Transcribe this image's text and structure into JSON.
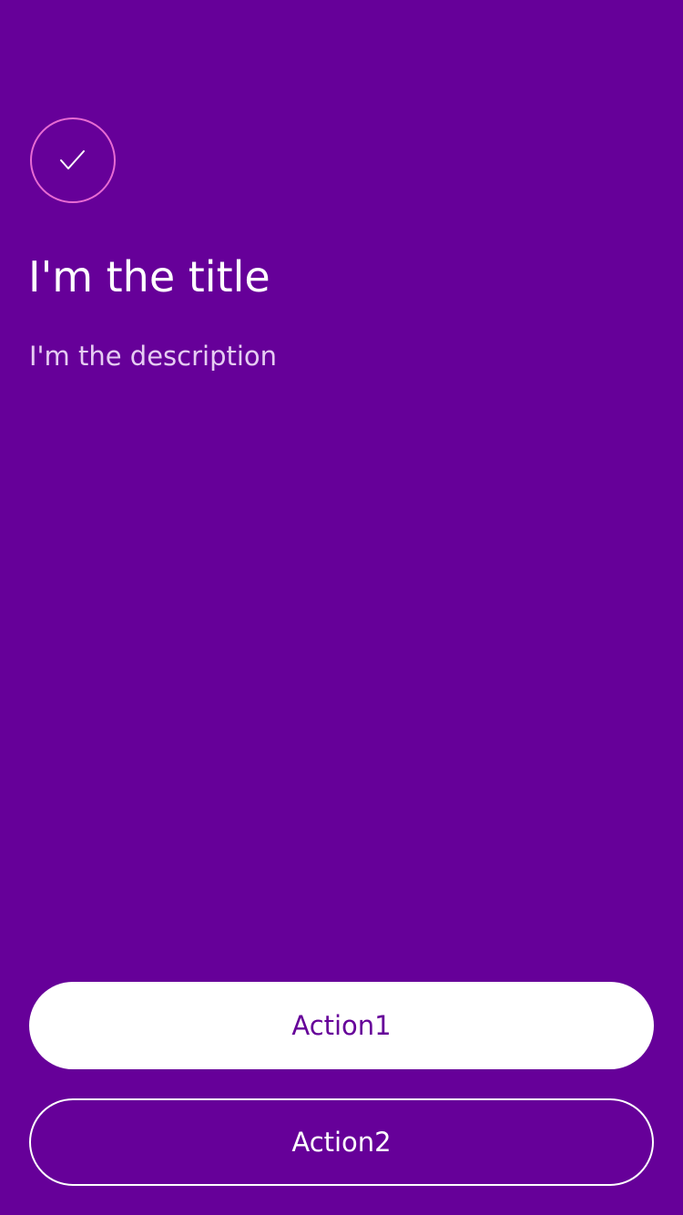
{
  "colors": {
    "background": "#660099",
    "icon_ring": "#E86BD3",
    "text_primary": "#FFFFFF",
    "text_secondary": "#E6CCF2",
    "primary_button_bg": "#FFFFFF",
    "primary_button_text": "#660099"
  },
  "icon": {
    "name": "check-icon"
  },
  "content": {
    "title": "I'm the title",
    "description": "I'm the description"
  },
  "actions": {
    "primary_label": "Action1",
    "secondary_label": "Action2"
  }
}
